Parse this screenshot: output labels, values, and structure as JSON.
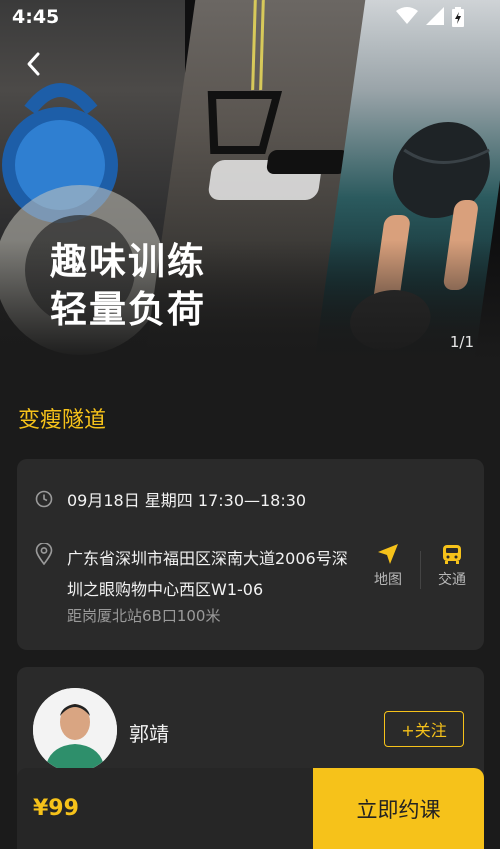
{
  "status_bar": {
    "time": "4:45"
  },
  "hero": {
    "title": "趣味训练\n轻量负荷",
    "pager": "1/1"
  },
  "class": {
    "name": "变瘦隧道",
    "datetime": "09月18日 星期四 17:30—18:30",
    "address": "广东省深圳市福田区深南大道2006号深圳之眼购物中心西区W1-06",
    "distance": "距岗厦北站6B口100米",
    "map_label": "地图",
    "transit_label": "交通"
  },
  "coach": {
    "name": "郭靖",
    "follow_label": "+关注"
  },
  "booking": {
    "price": "¥99",
    "button_label": "立即约课"
  },
  "colors": {
    "accent": "#f6c21a",
    "background": "#1b1b1b",
    "card": "#2a2a2a"
  },
  "icons": [
    "back-chevron-icon",
    "wifi-icon",
    "signal-icon",
    "battery-icon",
    "clock-icon",
    "location-pin-icon",
    "navigation-arrow-icon",
    "bus-icon"
  ]
}
